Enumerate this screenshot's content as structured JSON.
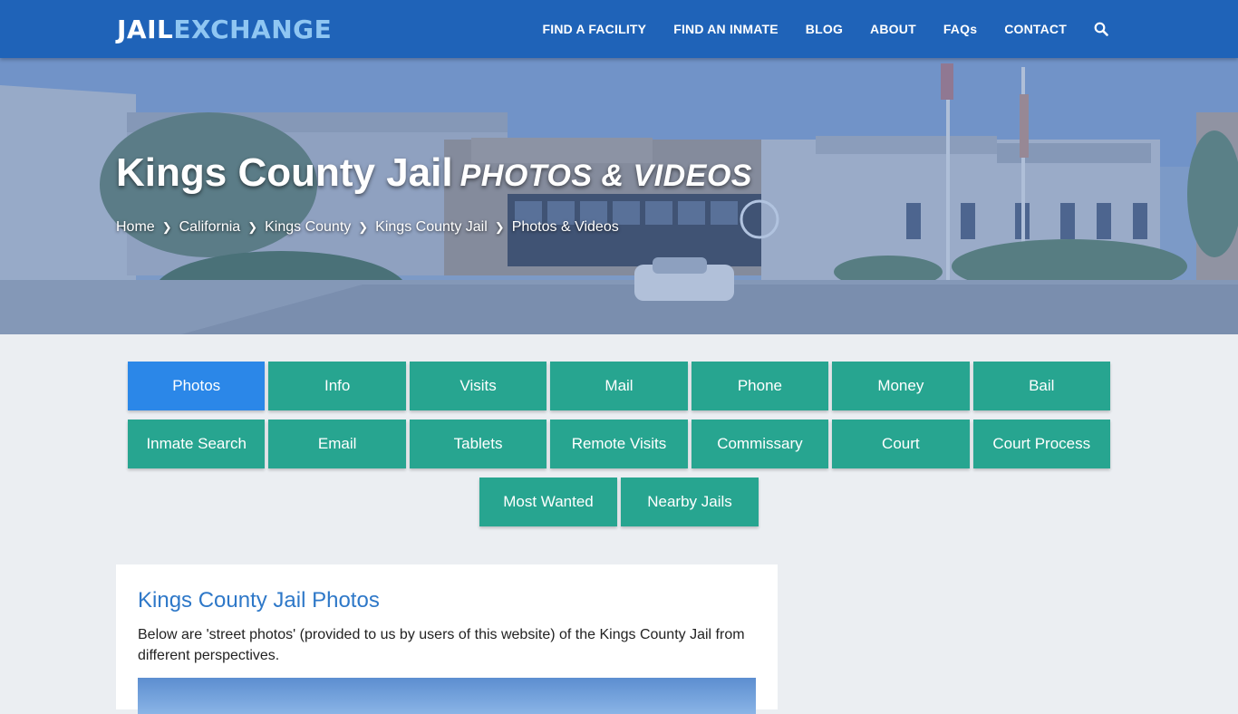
{
  "logo": {
    "part1": "JAIL",
    "part2": "EXCHANGE"
  },
  "nav": {
    "items": [
      "FIND A FACILITY",
      "FIND AN INMATE",
      "BLOG",
      "ABOUT",
      "FAQs",
      "CONTACT"
    ],
    "search_icon": "search-icon"
  },
  "hero": {
    "title": "Kings County Jail",
    "subtitle": "PHOTOS & VIDEOS",
    "breadcrumb": [
      "Home",
      "California",
      "Kings County",
      "Kings County Jail",
      "Photos & Videos"
    ]
  },
  "tabs": {
    "row1": [
      "Photos",
      "Info",
      "Visits",
      "Mail",
      "Phone",
      "Money",
      "Bail"
    ],
    "row2": [
      "Inmate Search",
      "Email",
      "Tablets",
      "Remote Visits",
      "Commissary",
      "Court",
      "Court Process"
    ],
    "row3": [
      "Most Wanted",
      "Nearby Jails"
    ],
    "active": "Photos"
  },
  "card": {
    "title": "Kings County Jail Photos",
    "text": "Below are 'street photos' (provided to us by users of this website) of the Kings County Jail from different perspectives."
  },
  "colors": {
    "nav": "#1f63b8",
    "tab": "#27a590",
    "tab_active": "#2b87e8",
    "card_title": "#2e78c8"
  }
}
